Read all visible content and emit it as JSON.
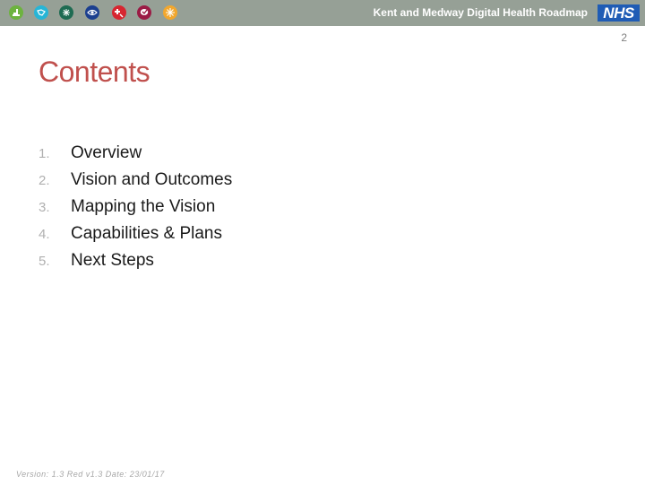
{
  "header": {
    "title": "Kent and Medway Digital Health Roadmap",
    "logo_text": "NHS",
    "icons": [
      {
        "name": "home-care-icon",
        "color": "#6db33f"
      },
      {
        "name": "connected-care-icon",
        "color": "#27b5d6"
      },
      {
        "name": "puzzle-integration-icon",
        "color": "#1e6b52"
      },
      {
        "name": "eye-icon",
        "color": "#1b3f8f"
      },
      {
        "name": "medical-cross-icon",
        "color": "#d72630"
      },
      {
        "name": "heart-speech-icon",
        "color": "#9b1b45"
      },
      {
        "name": "snowflake-icon",
        "color": "#f2a72e"
      }
    ]
  },
  "page_number": "2",
  "title": "Contents",
  "contents": [
    {
      "number": "1.",
      "label": "Overview"
    },
    {
      "number": "2.",
      "label": "Vision and Outcomes"
    },
    {
      "number": "3.",
      "label": "Mapping the Vision"
    },
    {
      "number": "4.",
      "label": "Capabilities & Plans"
    },
    {
      "number": "5.",
      "label": "Next Steps"
    }
  ],
  "footer": "Version: 1.3 Red v1.3 Date: 23/01/17",
  "colors": {
    "header_bar": "#96a096",
    "title": "#c0504d",
    "nhs_blue": "#1f5cb5"
  }
}
